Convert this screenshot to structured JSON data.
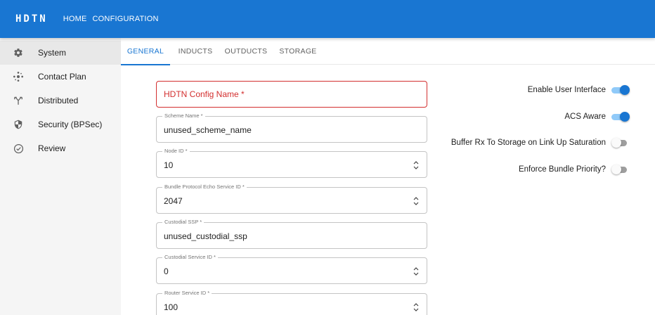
{
  "app": {
    "logo": "HDTN",
    "nav": [
      "HOME",
      "CONFIGURATION"
    ]
  },
  "colors": {
    "primary": "#1976d2",
    "error": "#d32f2f",
    "sidebar_bg": "#f5f5f5"
  },
  "sidebar": {
    "items": [
      {
        "label": "System",
        "icon": "gear-icon",
        "active": true
      },
      {
        "label": "Contact Plan",
        "icon": "network-icon",
        "active": false
      },
      {
        "label": "Distributed",
        "icon": "merge-icon",
        "active": false
      },
      {
        "label": "Security (BPSec)",
        "icon": "shield-icon",
        "active": false
      },
      {
        "label": "Review",
        "icon": "check-circle-icon",
        "active": false
      }
    ]
  },
  "tabs": [
    {
      "label": "GENERAL",
      "active": true
    },
    {
      "label": "INDUCTS",
      "active": false
    },
    {
      "label": "OUTDUCTS",
      "active": false
    },
    {
      "label": "STORAGE",
      "active": false
    }
  ],
  "form": {
    "config_name": {
      "placeholder": "HDTN Config Name *"
    },
    "fields": [
      {
        "label": "Scheme Name *",
        "value": "unused_scheme_name",
        "numeric": false
      },
      {
        "label": "Node ID *",
        "value": "10",
        "numeric": true
      },
      {
        "label": "Bundle Protocol Echo Service ID *",
        "value": "2047",
        "numeric": true
      },
      {
        "label": "Custodial SSP *",
        "value": "unused_custodial_ssp",
        "numeric": false
      },
      {
        "label": "Custodial Service ID *",
        "value": "0",
        "numeric": true
      },
      {
        "label": "Router Service ID *",
        "value": "100",
        "numeric": true
      }
    ]
  },
  "toggles": [
    {
      "label": "Enable User Interface",
      "on": true
    },
    {
      "label": "ACS Aware",
      "on": true
    },
    {
      "label": "Buffer Rx To Storage on Link Up Saturation",
      "on": false
    },
    {
      "label": "Enforce Bundle Priority?",
      "on": false
    }
  ]
}
